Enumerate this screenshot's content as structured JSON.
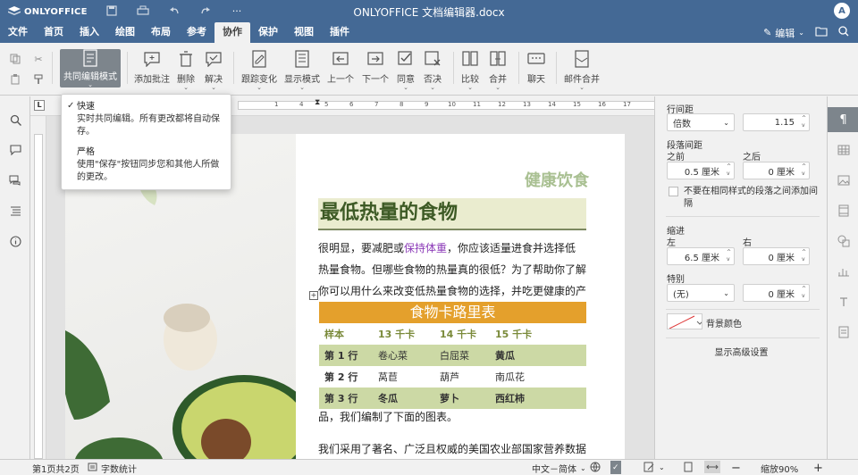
{
  "app": {
    "logo": "ONLYOFFICE",
    "doc_title": "ONLYOFFICE 文档编辑器.docx",
    "avatar": "A"
  },
  "menu": [
    "文件",
    "首页",
    "插入",
    "绘图",
    "布局",
    "参考",
    "协作",
    "保护",
    "视图",
    "插件"
  ],
  "menu_active": "协作",
  "header_right": {
    "edit_label": "编辑"
  },
  "toolbar": {
    "coedit": "共同编辑模式",
    "add_comment": "添加批注",
    "delete": "删除",
    "resolve": "解决",
    "track_changes": "跟踪变化",
    "display_mode": "显示模式",
    "prev": "上一个",
    "next": "下一个",
    "accept": "同意",
    "reject": "否决",
    "compare": "比较",
    "merge": "合并",
    "chat": "聊天",
    "mail_merge": "邮件合并"
  },
  "popup": {
    "fast_title": "快速",
    "fast_desc": "实时共同编辑。所有更改都将自动保存。",
    "strict_title": "严格",
    "strict_desc": "使用\"保存\"按钮同步您和其他人所做的更改。"
  },
  "ruler": {
    "numbers": [
      "1",
      "4",
      "5",
      "6",
      "7",
      "8",
      "9",
      "10",
      "11",
      "12",
      "13",
      "14",
      "15",
      "16",
      "17"
    ]
  },
  "document": {
    "healthy": "健康饮食",
    "heading": "最低热量的食物",
    "para_a": "很明显，要减肥或",
    "para_link": "保持体重",
    "para_b": "，你应该适量进食并选择低热量食物。但哪些食物的热量真的很低？为了帮助你了解你可以用什么来改变低热量食物的选择，并吃更健康的产",
    "table": {
      "title": "食物卡路里表",
      "header": [
        "样本",
        "13 千卡",
        "14 千卡",
        "15 千卡"
      ],
      "rows": [
        [
          "第 1 行",
          "卷心菜",
          "白屈菜",
          "黄瓜"
        ],
        [
          "第 2 行",
          "莴苣",
          "葫芦",
          "南瓜花"
        ],
        [
          "第 3 行",
          "冬瓜",
          "萝卜",
          "西红柿"
        ]
      ]
    },
    "after1": "品，我们编制了下面的图表。",
    "after2": "我们采用了著名、广泛且权威的美国农业部国家营养数据"
  },
  "panel": {
    "line_spacing": "行间距",
    "line_mode": "倍数",
    "line_value": "1.15",
    "para_spacing": "段落间距",
    "before": "之前",
    "after": "之后",
    "before_value": "0.5 厘米",
    "after_value": "0 厘米",
    "no_space_label": "不要在相同样式的段落之间添加间隔",
    "indent": "缩进",
    "left": "左",
    "right": "右",
    "left_value": "6.5 厘米",
    "right_value": "0 厘米",
    "special": "特别",
    "special_value": "(无)",
    "special_amount": "0 厘米",
    "bg_color": "背景颜色",
    "advanced": "显示高级设置"
  },
  "status": {
    "page": "第1页共2页",
    "word_count": "字数统计",
    "language": "中文－简体",
    "zoom": "缩放90%"
  },
  "colors": {
    "brand": "#446995",
    "heading_bg": "#eaeccf",
    "table_title": "#e4a02c",
    "table_shade": "#ccd9a5",
    "link": "#8c3bb8"
  }
}
